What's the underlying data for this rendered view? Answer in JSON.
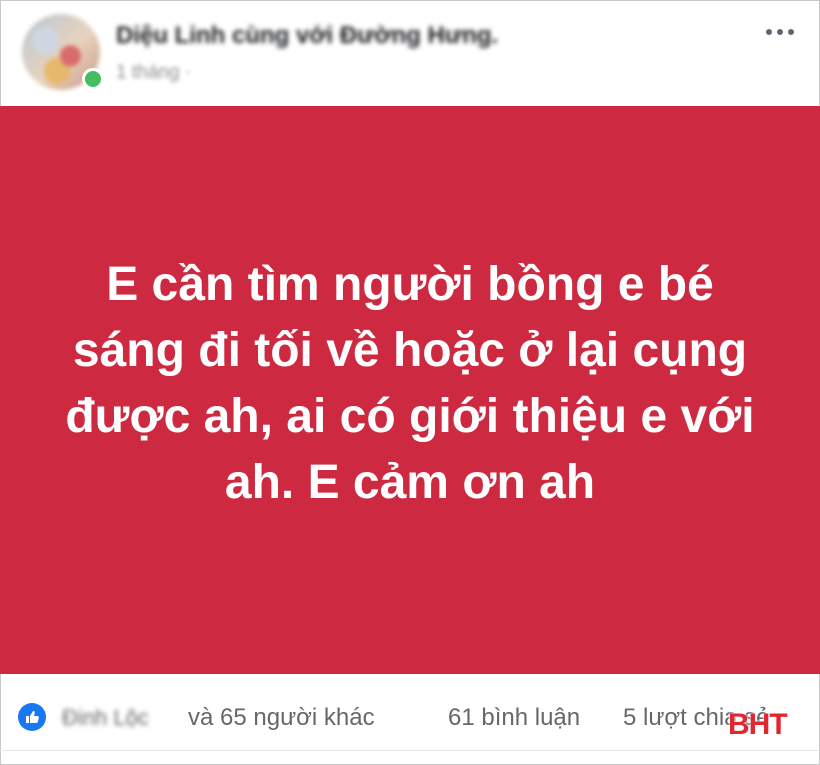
{
  "post": {
    "author": "Diệu Linh cùng với Đường Hưng.",
    "meta": "1 tháng · ",
    "text": "E cần tìm người bồng e bé sáng đi tối về hoặc ở lại cụng được ah, ai có giới thiệu e với ah. E cảm ơn ah",
    "background_color": "#cd2a41"
  },
  "footer": {
    "reactor_name": "Đinh Lộc",
    "reactions": "và 65 người khác",
    "comments": "61 bình luận",
    "shares": "5 lượt chia sẻ",
    "reaction_icon": "like-icon"
  },
  "watermark": "BHT"
}
